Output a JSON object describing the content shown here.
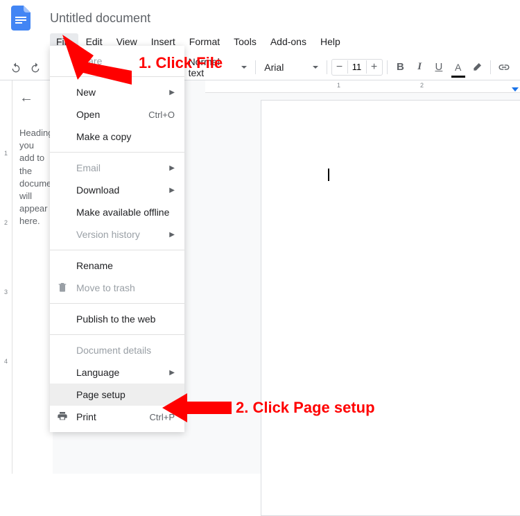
{
  "header": {
    "title": "Untitled document"
  },
  "menubar": {
    "items": [
      "File",
      "Edit",
      "View",
      "Insert",
      "Format",
      "Tools",
      "Add-ons",
      "Help"
    ]
  },
  "toolbar": {
    "paragraph_style": "Normal text",
    "font": "Arial",
    "font_size": "11"
  },
  "outline": {
    "placeholder": "Headings you add to the document will appear here."
  },
  "ruler_h": [
    "1",
    "2"
  ],
  "ruler_v": [
    "1",
    "2",
    "3",
    "4"
  ],
  "file_menu": {
    "groups": [
      [
        {
          "label": "Share",
          "disabled": true
        }
      ],
      [
        {
          "label": "New",
          "submenu": true
        },
        {
          "label": "Open",
          "shortcut": "Ctrl+O"
        },
        {
          "label": "Make a copy"
        }
      ],
      [
        {
          "label": "Email",
          "disabled": true,
          "submenu": true
        },
        {
          "label": "Download",
          "submenu": true
        },
        {
          "label": "Make available offline"
        },
        {
          "label": "Version history",
          "disabled": true,
          "submenu": true
        }
      ],
      [
        {
          "label": "Rename"
        },
        {
          "label": "Move to trash",
          "disabled": true,
          "icon": "trash"
        }
      ],
      [
        {
          "label": "Publish to the web"
        }
      ],
      [
        {
          "label": "Document details",
          "disabled": true
        },
        {
          "label": "Language",
          "submenu": true
        },
        {
          "label": "Page setup",
          "highlighted": true
        },
        {
          "label": "Print",
          "shortcut": "Ctrl+P",
          "icon": "print"
        }
      ]
    ]
  },
  "annotations": {
    "step1": "1. Click File",
    "step2": "2. Click Page setup"
  }
}
